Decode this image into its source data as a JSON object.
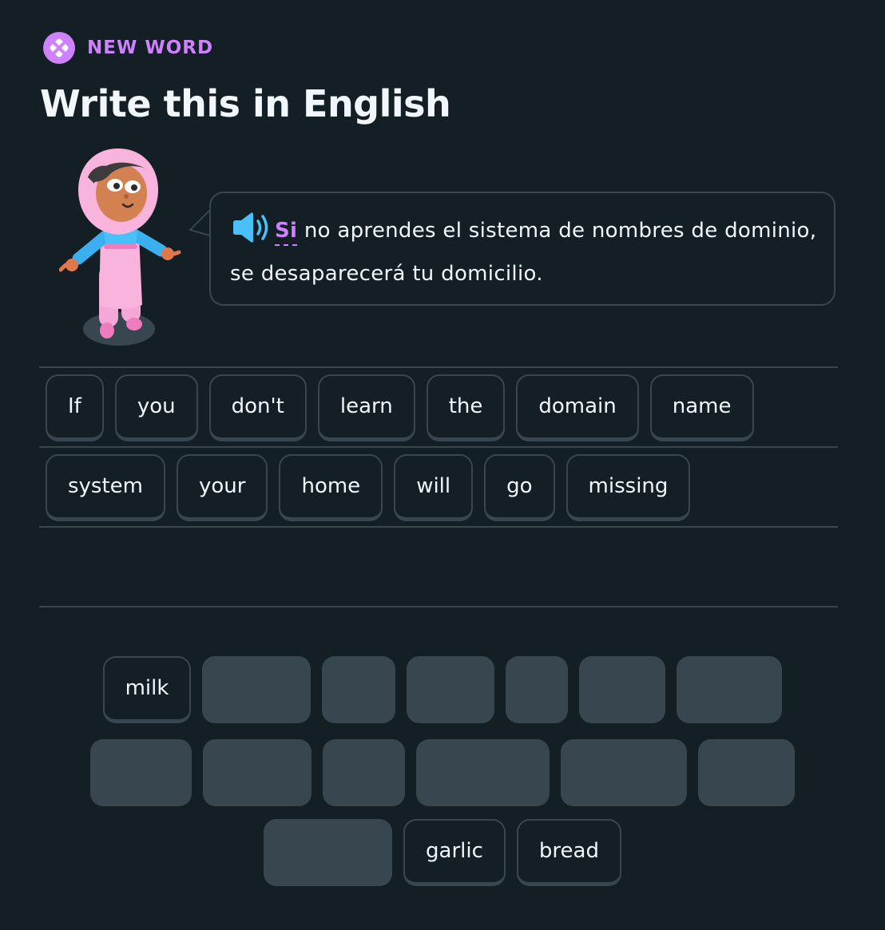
{
  "header": {
    "badge_label": "NEW WORD",
    "badge_color": "#ce82ff",
    "badge_icon": "puzzle-diamond-icon",
    "title": "Write this in English"
  },
  "prompt": {
    "speaker_icon": "speaker-icon",
    "hint_word": "Si",
    "sentence_rest": " no aprendes el sistema de nombres de dominio, se desaparecerá tu domicilio."
  },
  "answer": {
    "lines": [
      [
        "If",
        "you",
        "don't",
        "learn",
        "the",
        "domain",
        "name"
      ],
      [
        "system",
        "your",
        "home",
        "will",
        "go",
        "missing"
      ]
    ]
  },
  "word_bank": {
    "available_words": [
      "milk",
      "garlic",
      "bread"
    ]
  },
  "colors": {
    "background": "#131f24",
    "border": "#37464f",
    "accent": "#ce82ff",
    "speaker": "#49c0f8",
    "text": "#f1f7fb"
  }
}
